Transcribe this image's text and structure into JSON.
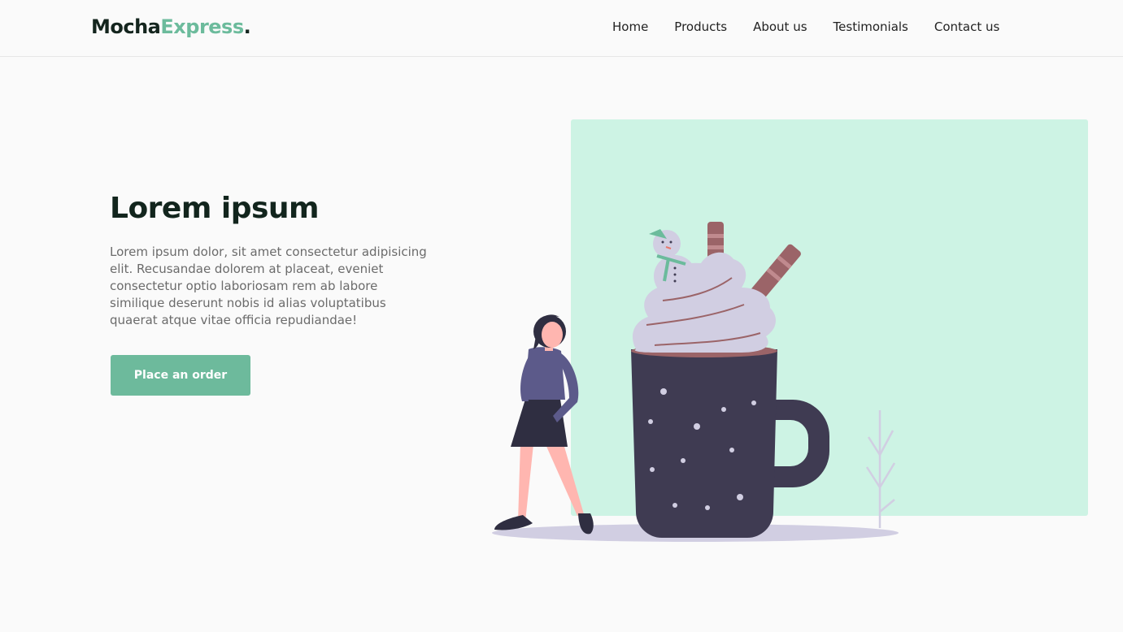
{
  "header": {
    "logo": {
      "part1": "Mocha",
      "part2": "Express",
      "dot": "."
    },
    "nav": [
      "Home",
      "Products",
      "About us",
      "Testimonials",
      "Contact us"
    ]
  },
  "hero": {
    "title": "Lorem ipsum",
    "text": "Lorem ipsum dolor, sit amet consectetur adipisicing elit. Recusandae dolorem at placeat, eveniet consectetur optio laboriosam rem ab labore similique deserunt nobis id alias voluptatibus quaerat atque vitae officia repudiandae!",
    "cta_label": "Place an order"
  },
  "colors": {
    "accent": "#6cbb9c",
    "panel": "#cdf3e4",
    "mug": "#3f3b52",
    "cream": "#d1cee2",
    "straw": "#9b6468"
  },
  "illustration": {
    "name": "woman-with-hot-chocolate-illustration"
  }
}
